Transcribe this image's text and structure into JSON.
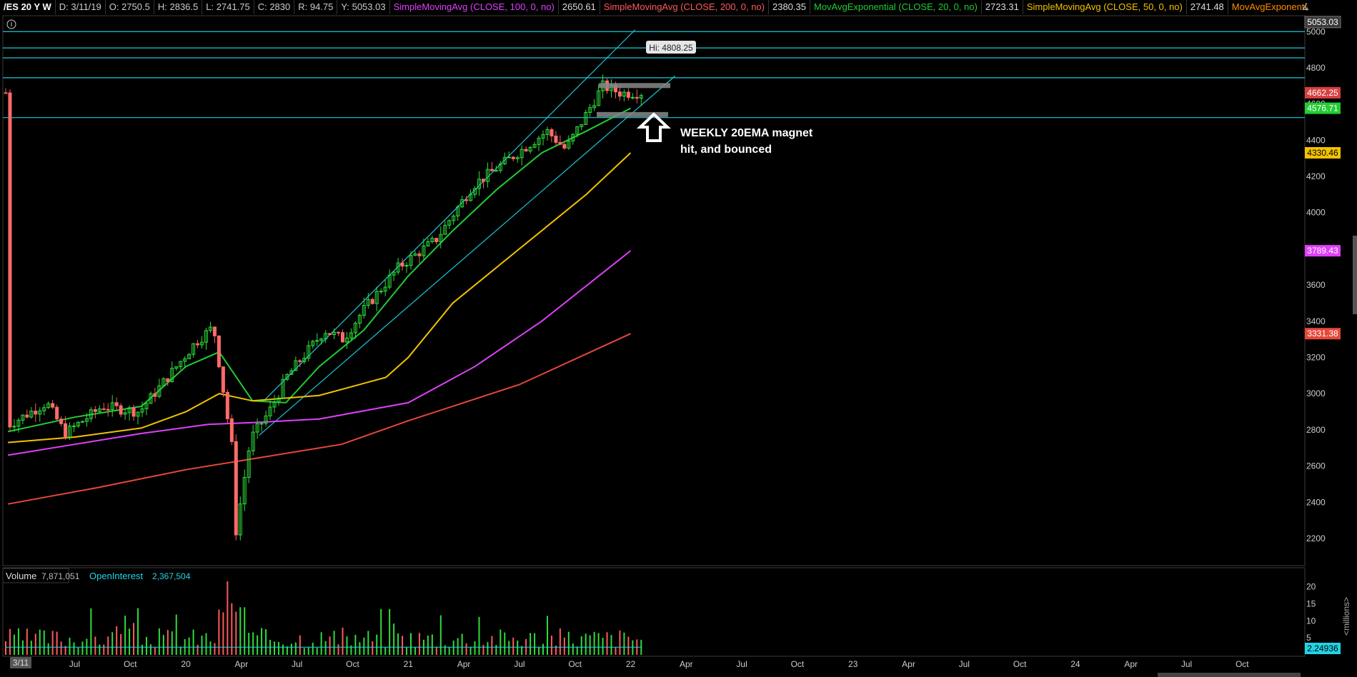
{
  "header": {
    "symbol": "/ES 20 Y W",
    "date": "D: 3/11/19",
    "open": "O: 2750.5",
    "high": "H: 2836.5",
    "low": "L: 2741.75",
    "close": "C: 2830",
    "range": "R: 94.75",
    "y": "Y: 5053.03",
    "studies": [
      {
        "label": "SimpleMovingAvg (CLOSE, 100, 0, no)",
        "value": "2650.61",
        "color": "#e040fb"
      },
      {
        "label": "SimpleMovingAvg (CLOSE, 200, 0, no)",
        "value": "2380.35",
        "color": "#ff5a5a"
      },
      {
        "label": "MovAvgExponential (CLOSE, 20, 0, no)",
        "value": "2723.31",
        "color": "#22cc33"
      },
      {
        "label": "SimpleMovingAvg (CLOSE, 50, 0, no)",
        "value": "2741.48",
        "color": "#f2c200"
      },
      {
        "label": "MovAvgExponential (CLOSE,...",
        "value": "",
        "color": "#ff8c00"
      }
    ]
  },
  "price_labels": [
    {
      "text": "5053.03",
      "value": 5053.03,
      "bg": "#3a3a3a",
      "fg": "#ffffff"
    },
    {
      "text": "4662.25",
      "value": 4662.25,
      "bg": "#d84040",
      "fg": "#ffffff"
    },
    {
      "text": "4576.71",
      "value": 4576.71,
      "bg": "#22cc33",
      "fg": "#ffffff"
    },
    {
      "text": "4330.46",
      "value": 4330.46,
      "bg": "#f2c200",
      "fg": "#000000"
    },
    {
      "text": "3789.43",
      "value": 3789.43,
      "bg": "#e040fb",
      "fg": "#ffffff"
    },
    {
      "text": "3331.38",
      "value": 3331.38,
      "bg": "#e5483a",
      "fg": "#ffffff"
    }
  ],
  "annotation": {
    "hi_label": "Hi: 4808.25",
    "line1": "WEEKLY 20EMA magnet",
    "line2": "hit, and bounced"
  },
  "volume_panel": {
    "label": "Volume",
    "volume": "7,871,051",
    "oi_label": "OpenInterest",
    "oi": "2,367,504",
    "oi_badge": "2.24936",
    "unit": "<millions>",
    "ticks": [
      "20",
      "15",
      "10",
      "5"
    ]
  },
  "x_axis": {
    "start_badge": "3/11",
    "labels": [
      "Jul",
      "Oct",
      "20",
      "Apr",
      "Jul",
      "Oct",
      "21",
      "Apr",
      "Jul",
      "Oct",
      "22",
      "Apr",
      "Jul",
      "Oct",
      "23",
      "Apr",
      "Jul",
      "Oct",
      "24",
      "Apr",
      "Jul",
      "Oct"
    ]
  },
  "chart_data": {
    "type": "candlestick",
    "y_ticks": [
      2200,
      2400,
      2600,
      2800,
      3000,
      3200,
      3400,
      3600,
      3800,
      4000,
      4200,
      4400,
      4600,
      4800,
      5000
    ],
    "ylim": [
      2050,
      5080
    ],
    "horizontal_levels": [
      5000,
      4910,
      4855,
      4745,
      4525
    ],
    "close_path": [
      [
        "2019-03",
        2830
      ],
      [
        "2019-05",
        2950
      ],
      [
        "2019-06",
        2780
      ],
      [
        "2019-08",
        2930
      ],
      [
        "2019-10",
        2900
      ],
      [
        "2019-12",
        3150
      ],
      [
        "2020-01",
        3280
      ],
      [
        "2020-02",
        3370
      ],
      [
        "2020-03",
        2700
      ],
      [
        "2020-03-20",
        2210
      ],
      [
        "2020-04",
        2750
      ],
      [
        "2020-05",
        2900
      ],
      [
        "2020-06",
        3100
      ],
      [
        "2020-08",
        3350
      ],
      [
        "2020-09",
        3300
      ],
      [
        "2020-10",
        3450
      ],
      [
        "2020-12",
        3700
      ],
      [
        "2021-02",
        3850
      ],
      [
        "2021-04",
        4150
      ],
      [
        "2021-06",
        4300
      ],
      [
        "2021-08",
        4450
      ],
      [
        "2021-09",
        4350
      ],
      [
        "2021-11",
        4700
      ],
      [
        "2021-12",
        4660
      ],
      [
        "2022-01",
        4662.25
      ]
    ],
    "series": [
      {
        "name": "MovAvgExponential (CLOSE, 20, 0, no)",
        "color": "#22cc33",
        "values": [
          [
            2019.2,
            2790
          ],
          [
            2019.5,
            2870
          ],
          [
            2019.8,
            2930
          ],
          [
            2020.0,
            3150
          ],
          [
            2020.15,
            3230
          ],
          [
            2020.3,
            2960
          ],
          [
            2020.45,
            2950
          ],
          [
            2020.6,
            3150
          ],
          [
            2020.8,
            3350
          ],
          [
            2021.0,
            3650
          ],
          [
            2021.2,
            3900
          ],
          [
            2021.4,
            4130
          ],
          [
            2021.6,
            4330
          ],
          [
            2021.8,
            4450
          ],
          [
            2022.0,
            4576.71
          ]
        ]
      },
      {
        "name": "SimpleMovingAvg (CLOSE, 50, 0, no)",
        "color": "#f2c200",
        "values": [
          [
            2019.2,
            2730
          ],
          [
            2019.5,
            2760
          ],
          [
            2019.8,
            2810
          ],
          [
            2020.0,
            2900
          ],
          [
            2020.15,
            3000
          ],
          [
            2020.3,
            2960
          ],
          [
            2020.6,
            2990
          ],
          [
            2020.9,
            3090
          ],
          [
            2021.0,
            3200
          ],
          [
            2021.2,
            3500
          ],
          [
            2021.5,
            3800
          ],
          [
            2021.8,
            4100
          ],
          [
            2022.0,
            4330.46
          ]
        ]
      },
      {
        "name": "SimpleMovingAvg (CLOSE, 100, 0, no)",
        "color": "#e040fb",
        "values": [
          [
            2019.2,
            2660
          ],
          [
            2019.5,
            2720
          ],
          [
            2019.8,
            2780
          ],
          [
            2020.1,
            2830
          ],
          [
            2020.3,
            2840
          ],
          [
            2020.6,
            2860
          ],
          [
            2021.0,
            2950
          ],
          [
            2021.3,
            3150
          ],
          [
            2021.6,
            3400
          ],
          [
            2022.0,
            3789.43
          ]
        ]
      },
      {
        "name": "SimpleMovingAvg (CLOSE, 200, 0, no)",
        "color": "#e5483a",
        "values": [
          [
            2019.2,
            2390
          ],
          [
            2019.6,
            2480
          ],
          [
            2020.0,
            2580
          ],
          [
            2020.3,
            2640
          ],
          [
            2020.7,
            2720
          ],
          [
            2021.0,
            2850
          ],
          [
            2021.5,
            3050
          ],
          [
            2022.0,
            3331.38
          ]
        ]
      }
    ],
    "volume_range": [
      0,
      22
    ]
  }
}
